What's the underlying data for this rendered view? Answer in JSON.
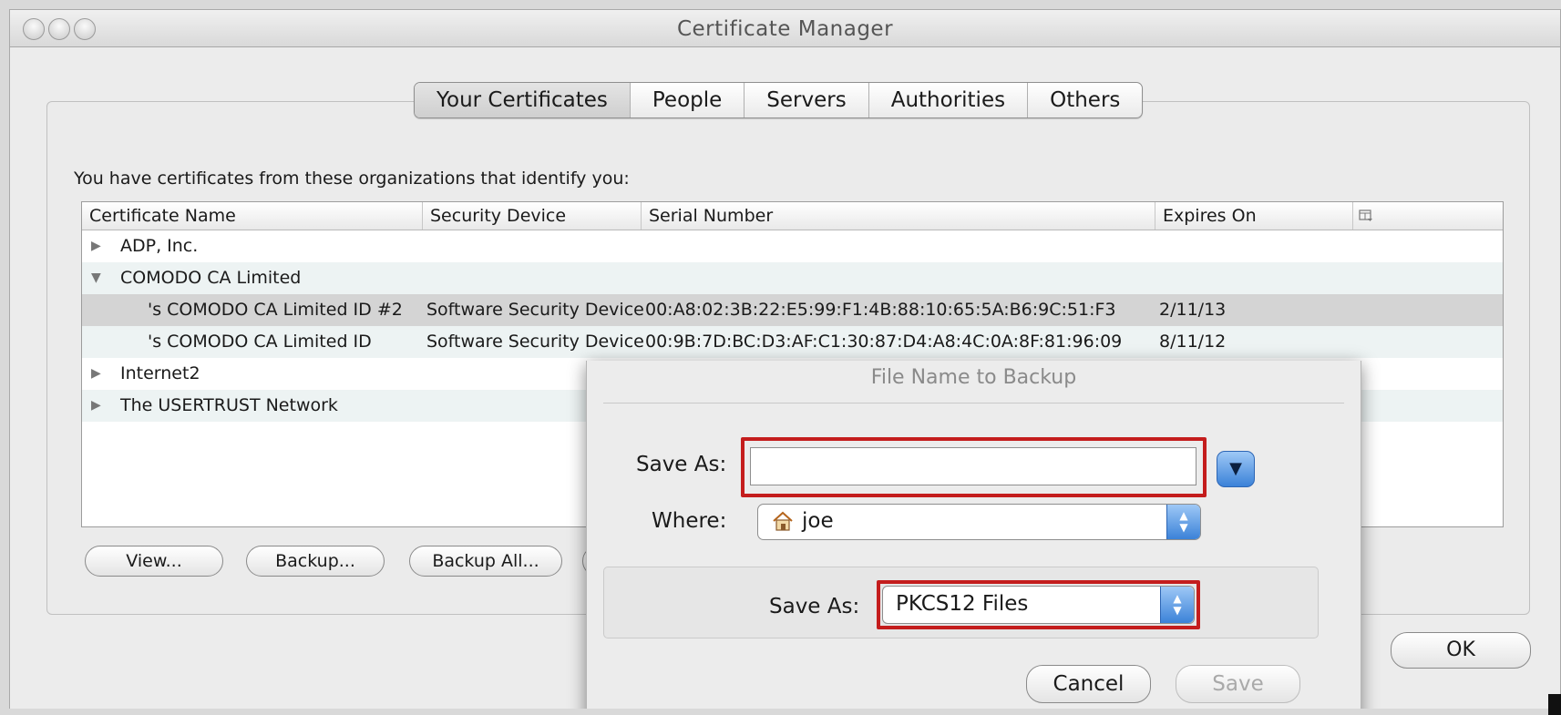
{
  "window": {
    "title": "Certificate Manager"
  },
  "tabs": [
    {
      "label": "Your Certificates",
      "selected": true
    },
    {
      "label": "People"
    },
    {
      "label": "Servers"
    },
    {
      "label": "Authorities"
    },
    {
      "label": "Others"
    }
  ],
  "intro_text": "You have certificates from these organizations that identify you:",
  "table": {
    "headers": [
      "Certificate Name",
      "Security Device",
      "Serial Number",
      "Expires On"
    ],
    "column_picker_icon": "column-picker-icon",
    "rows": [
      {
        "name": "ADP, Inc.",
        "expander": "collapsed"
      },
      {
        "name": "COMODO CA Limited",
        "expander": "expanded"
      },
      {
        "name": "'s COMODO CA Limited ID #2",
        "device": "Software Security Device",
        "serial": "00:A8:02:3B:22:E5:99:F1:4B:88:10:65:5A:B6:9C:51:F3",
        "expires": "2/11/13",
        "selected": true
      },
      {
        "name": "'s COMODO CA Limited ID",
        "device": "Software Security Device",
        "serial": "00:9B:7D:BC:D3:AF:C1:30:87:D4:A8:4C:0A:8F:81:96:09",
        "expires": "8/11/12"
      },
      {
        "name": "Internet2",
        "expander": "collapsed"
      },
      {
        "name": "The USERTRUST Network",
        "expander": "collapsed"
      }
    ]
  },
  "buttons": {
    "view": "View...",
    "backup": "Backup...",
    "backup_all": "Backup All...",
    "ok": "OK"
  },
  "dialog": {
    "title": "File Name to Backup",
    "save_as_label": "Save As:",
    "save_as_value": "",
    "where_label": "Where:",
    "where_value": "joe",
    "where_icon": "home-folder-icon",
    "format_label": "Save As:",
    "format_value": "PKCS12 Files",
    "cancel": "Cancel",
    "save": "Save"
  },
  "colors": {
    "highlight": "#c41d1d",
    "accent": "#3b82d8"
  }
}
